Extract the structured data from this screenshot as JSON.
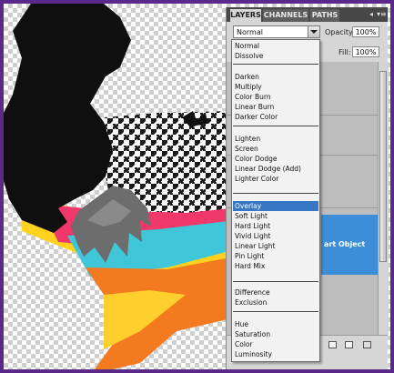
{
  "panel_tabs": [
    "LAYERS",
    "CHANNELS",
    "PATHS"
  ],
  "panel_controls": {
    "collapse": "◂",
    "menu": "▾≡"
  },
  "blend_mode": "Normal",
  "opacity": {
    "label": "Opacity:",
    "value": "100%"
  },
  "fill": {
    "label": "Fill:",
    "value": "100%"
  },
  "selected_layer_text": "art Object",
  "blend_menu": {
    "groups": [
      [
        "Normal",
        "Dissolve"
      ],
      [
        "Darken",
        "Multiply",
        "Color Burn",
        "Linear Burn",
        "Darker Color"
      ],
      [
        "Lighten",
        "Screen",
        "Color Dodge",
        "Linear Dodge (Add)",
        "Lighter Color"
      ],
      [
        "Overlay",
        "Soft Light",
        "Hard Light",
        "Vivid Light",
        "Linear Light",
        "Pin Light",
        "Hard Mix"
      ],
      [
        "Difference",
        "Exclusion"
      ],
      [
        "Hue",
        "Saturation",
        "Color",
        "Luminosity"
      ]
    ],
    "highlighted": "Overlay"
  },
  "bottom_icons": [
    "folder-icon",
    "new-layer-icon",
    "trash-icon"
  ],
  "colors": {
    "frame": "#5a2a8a",
    "menu_highlight": "#3877c5",
    "layer_selected": "#3c8ed9",
    "stripe_yellow": "#ffd21f",
    "stripe_pink": "#f0386a",
    "stripe_cyan": "#3fc6d8",
    "stripe_orange": "#f47a1f"
  }
}
